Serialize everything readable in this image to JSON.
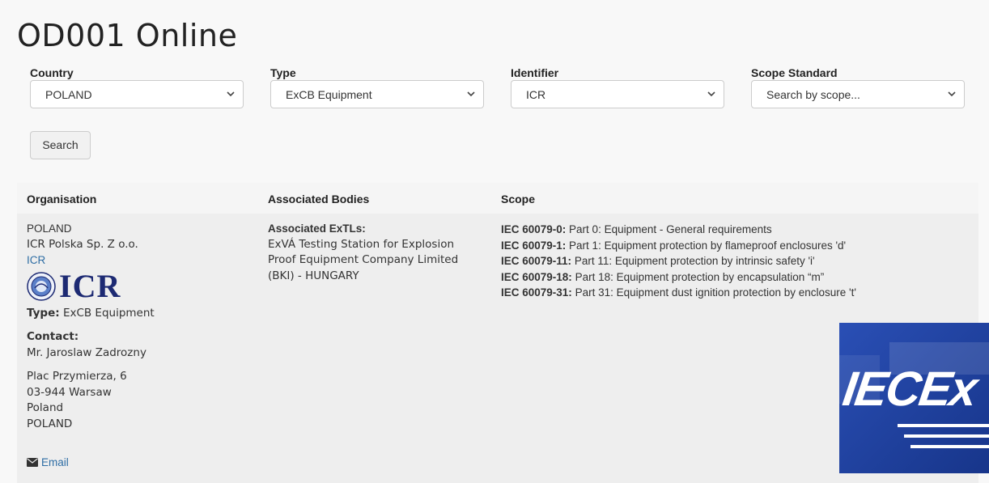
{
  "page": {
    "title": "OD001 Online"
  },
  "filters": [
    {
      "label": "Country",
      "value": "POLAND"
    },
    {
      "label": "Type",
      "value": "ExCB Equipment"
    },
    {
      "label": "Identifier",
      "value": "ICR"
    },
    {
      "label": "Scope Standard",
      "value": "Search by scope..."
    }
  ],
  "search_button": {
    "label": "Search"
  },
  "table": {
    "headers": {
      "organisation": "Organisation",
      "bodies": "Associated Bodies",
      "scope": "Scope"
    },
    "row": {
      "country": "POLAND",
      "org_name": "ICR Polska Sp. Z o.o.",
      "identifier_link": "ICR",
      "logo_text": "ICR",
      "type_label": "Type:",
      "type_value": "ExCB Equipment",
      "contact_label": "Contact:",
      "contact_name": "Mr. Jaroslaw Zadrozny",
      "address": [
        "Plac Przymierza, 6",
        "03-944 Warsaw",
        "Poland",
        "POLAND"
      ],
      "email_label": "Email",
      "bodies_label": "Associated ExTLs:",
      "bodies_lines": [
        "ExVÁ Testing Station for Explosion",
        "Proof Equipment Company Limited",
        "(BKI) - HUNGARY"
      ],
      "scope": [
        {
          "code": "IEC 60079-0:",
          "text": " Part 0: Equipment - General requirements"
        },
        {
          "code": "IEC 60079-1:",
          "text": " Part 1: Equipment protection by flameproof enclosures 'd'"
        },
        {
          "code": "IEC 60079-11:",
          "text": " Part 11: Equipment protection by intrinsic safety 'i'"
        },
        {
          "code": "IEC 60079-18:",
          "text": " Part 18: Equipment protection by encapsulation “m”"
        },
        {
          "code": "IEC 60079-31:",
          "text": " Part 31: Equipment dust ignition protection by enclosure 't'"
        }
      ]
    }
  },
  "brand_logo": {
    "text": "IECEx",
    "color": "#1e3f9e"
  },
  "icons": {
    "select_chevron": "chevron-down-icon",
    "email": "envelope-icon"
  }
}
